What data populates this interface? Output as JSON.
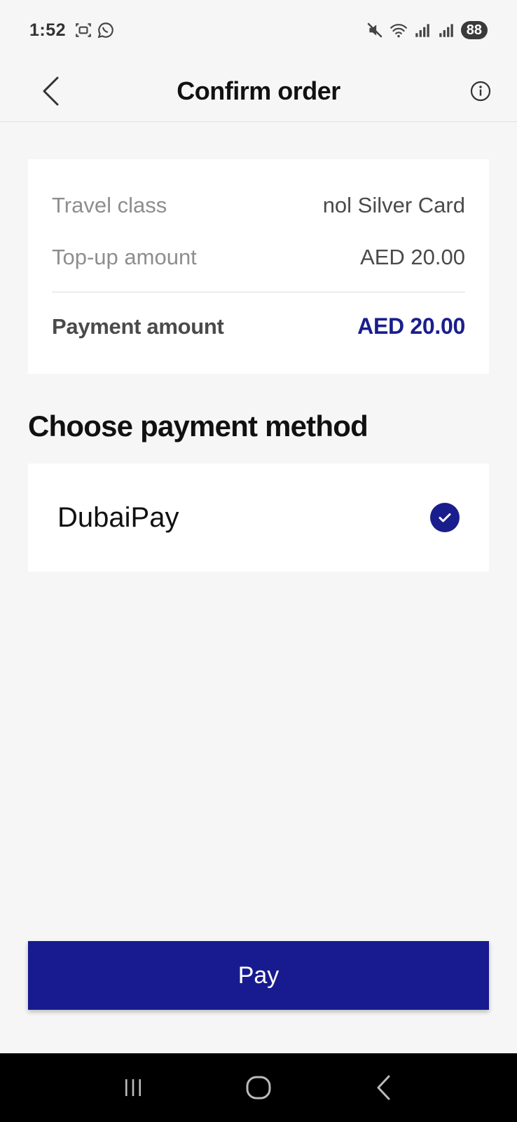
{
  "status_bar": {
    "time": "1:52",
    "battery": "88"
  },
  "header": {
    "title": "Confirm order"
  },
  "summary": {
    "rows": [
      {
        "label": "Travel class",
        "value": "nol Silver Card"
      },
      {
        "label": "Top-up amount",
        "value": "AED 20.00"
      }
    ],
    "total": {
      "label": "Payment amount",
      "value": "AED 20.00"
    }
  },
  "payment": {
    "heading": "Choose payment method",
    "options": [
      {
        "label": "DubaiPay",
        "selected": true
      }
    ]
  },
  "actions": {
    "pay_label": "Pay"
  },
  "colors": {
    "accent": "#1a1e8c",
    "background": "#f6f6f6"
  }
}
